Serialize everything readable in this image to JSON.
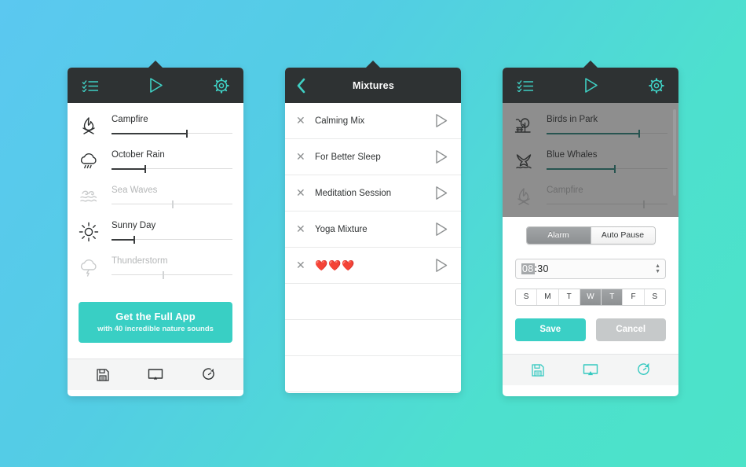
{
  "theme": {
    "bg_gradient_start": "#5bc8f0",
    "bg_gradient_end": "#4ce3c8",
    "header_bg": "#2e3233",
    "accent_teal": "#39cfc4",
    "header_icon_color": "#3fd0c4",
    "disabled_text": "#b5b7b8"
  },
  "panel_sounds": {
    "header": {
      "list_icon": "checklist-icon",
      "play_icon": "play-icon",
      "settings_icon": "gear-icon"
    },
    "sounds": [
      {
        "name": "Campfire",
        "icon": "campfire-icon",
        "enabled": true,
        "value": 62
      },
      {
        "name": "October Rain",
        "icon": "rain-cloud-icon",
        "enabled": true,
        "value": 27
      },
      {
        "name": "Sea Waves",
        "icon": "waves-icon",
        "enabled": false,
        "value": 50
      },
      {
        "name": "Sunny Day",
        "icon": "sun-icon",
        "enabled": true,
        "value": 18
      },
      {
        "name": "Thunderstorm",
        "icon": "thunderstorm-icon",
        "enabled": false,
        "value": 42
      }
    ],
    "promo": {
      "title": "Get the Full App",
      "subtitle": "with 40 incredible nature sounds"
    },
    "bottom_bar": {
      "save_icon": "floppy-save-icon",
      "cast_icon": "cast-icon",
      "timer_icon": "timer-icon"
    }
  },
  "panel_mixtures": {
    "header": {
      "back_icon": "chevron-left-icon",
      "title": "Mixtures"
    },
    "rows": [
      {
        "name": "Calming Mix",
        "delete_icon": "close-icon",
        "play_icon": "play-icon",
        "blank": false
      },
      {
        "name": "For Better Sleep",
        "delete_icon": "close-icon",
        "play_icon": "play-icon",
        "blank": false
      },
      {
        "name": "Meditation Session",
        "delete_icon": "close-icon",
        "play_icon": "play-icon",
        "blank": false
      },
      {
        "name": "Yoga Mixture",
        "delete_icon": "close-icon",
        "play_icon": "play-icon",
        "blank": false
      },
      {
        "name": "❤️❤️❤️",
        "delete_icon": "close-icon",
        "play_icon": "play-icon",
        "blank": false
      },
      {
        "name": "",
        "blank": true
      },
      {
        "name": "",
        "blank": true
      },
      {
        "name": "",
        "blank": true
      }
    ]
  },
  "panel_alarm": {
    "header": {
      "list_icon": "checklist-icon",
      "play_icon": "play-icon",
      "settings_icon": "gear-icon"
    },
    "sounds": [
      {
        "name": "Birds in Park",
        "icon": "tree-bird-icon",
        "enabled": true,
        "value": 76
      },
      {
        "name": "Blue Whales",
        "icon": "whale-tail-icon",
        "enabled": true,
        "value": 56
      },
      {
        "name": "Campfire",
        "icon": "campfire-icon",
        "enabled": false,
        "value": 80
      }
    ],
    "segments": [
      {
        "label": "Alarm",
        "selected": true
      },
      {
        "label": "Auto Pause",
        "selected": false
      }
    ],
    "time": {
      "hours": "08",
      "separator": ":",
      "minutes": "30",
      "stepper_up_icon": "chevron-up-icon",
      "stepper_down_icon": "chevron-down-icon"
    },
    "days": [
      {
        "label": "S",
        "selected": false
      },
      {
        "label": "M",
        "selected": false
      },
      {
        "label": "T",
        "selected": false
      },
      {
        "label": "W",
        "selected": true
      },
      {
        "label": "T",
        "selected": true
      },
      {
        "label": "F",
        "selected": false
      },
      {
        "label": "S",
        "selected": false
      }
    ],
    "save_label": "Save",
    "cancel_label": "Cancel",
    "bottom_bar": {
      "save_icon": "floppy-save-icon",
      "cast_icon": "cast-icon",
      "timer_icon": "timer-icon"
    }
  }
}
